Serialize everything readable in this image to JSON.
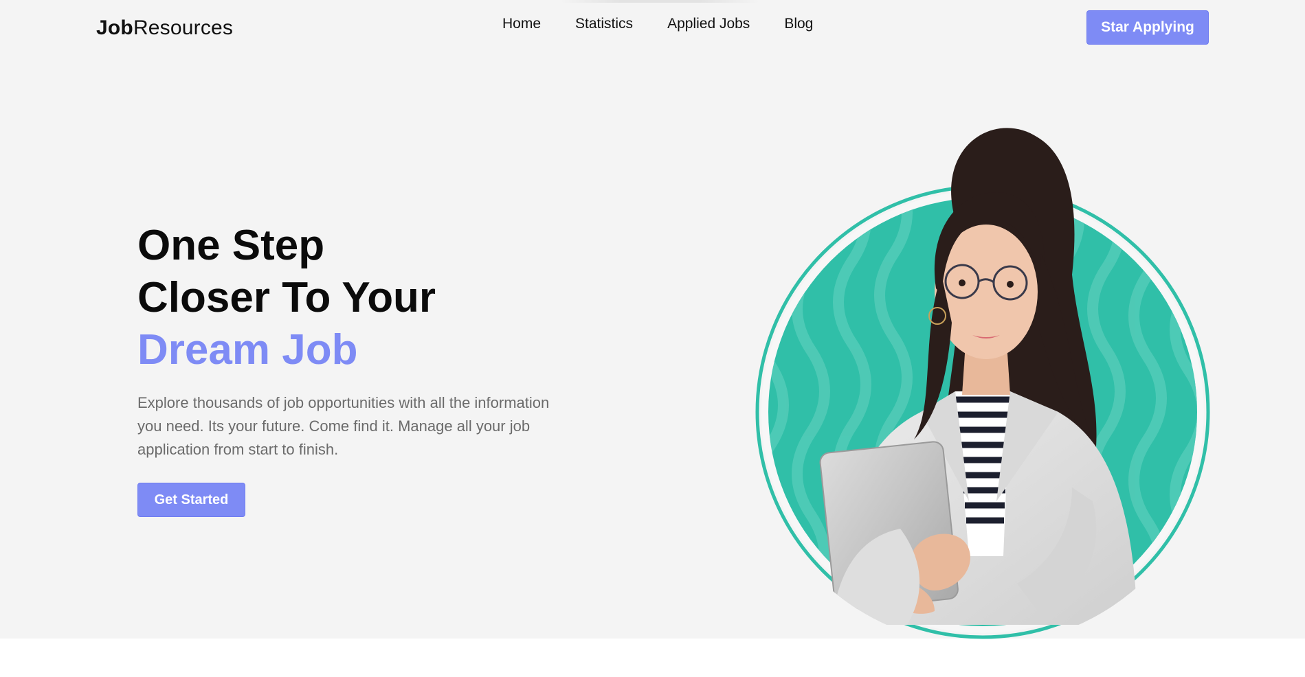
{
  "navbar": {
    "logo_bold": "Job",
    "logo_light": "Resources",
    "links": [
      {
        "label": "Home"
      },
      {
        "label": "Statistics"
      },
      {
        "label": "Applied Jobs"
      },
      {
        "label": "Blog"
      }
    ],
    "cta_label": "Star Applying"
  },
  "hero": {
    "headline_line1": "One Step",
    "headline_line2": "Closer To Your",
    "headline_accent": "Dream Job",
    "description": "Explore thousands of job opportunities with all the information you need. Its your future. Come find it. Manage all your job application from start to finish.",
    "cta_label": "Get Started"
  },
  "colors": {
    "accent": "#7e8bf5",
    "hero_bg": "#f4f4f4",
    "teal": "#30bfa8",
    "text_muted": "#6b6b6b"
  },
  "icons": {
    "hero_image": "woman-with-laptop-portrait"
  }
}
